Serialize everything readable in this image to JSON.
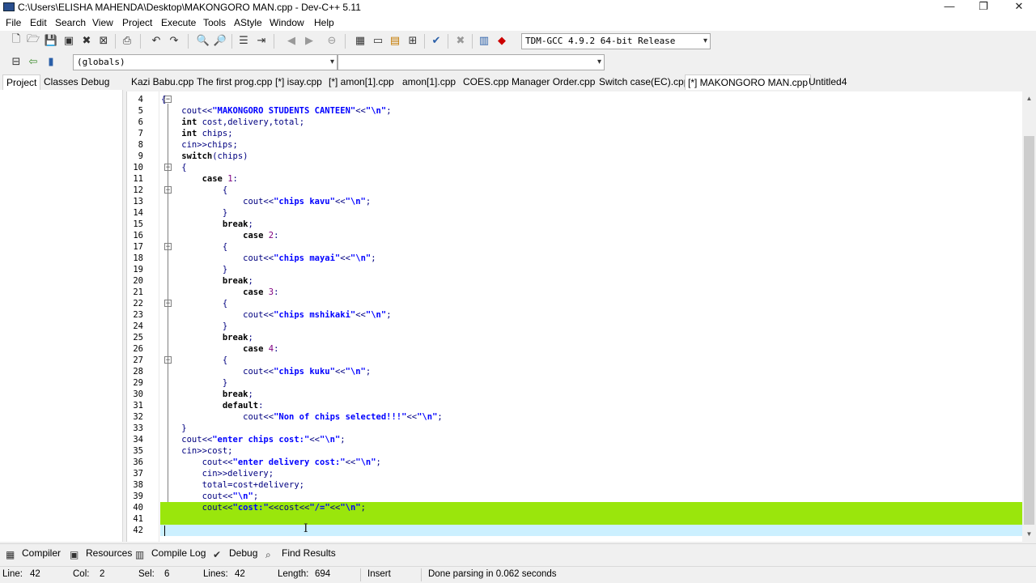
{
  "window": {
    "title": "C:\\Users\\ELISHA MAHENDA\\Desktop\\MAKONGORO MAN.cpp - Dev-C++ 5.11",
    "controls": {
      "minimize": "—",
      "maximize": "❐",
      "close": "✕"
    }
  },
  "menu": [
    "File",
    "Edit",
    "Search",
    "View",
    "Project",
    "Execute",
    "Tools",
    "AStyle",
    "Window",
    "Help"
  ],
  "toolbar": {
    "compiler_select": "TDM-GCC 4.9.2 64-bit Release",
    "scope_select": "(globals)",
    "function_select": ""
  },
  "left_tabs": [
    "Project",
    "Classes",
    "Debug"
  ],
  "editor_tabs": [
    "Kazi Babu.cpp",
    "The first prog.cpp",
    "[*] isay.cpp",
    "[*] amon[1].cpp",
    "amon[1].cpp",
    "COES.cpp",
    "Manager Order.cpp",
    "Switch case(EC).cpp",
    "[*] MAKONGORO MAN.cpp",
    "Untitled4"
  ],
  "active_tab": "[*] MAKONGORO MAN.cpp",
  "code_lines": [
    {
      "n": "4",
      "t": "{"
    },
    {
      "n": "5",
      "t": "    cout<<\"MAKONGORO STUDENTS CANTEEN\"<<\"\\n\";"
    },
    {
      "n": "6",
      "t": "    int cost,delivery,total;"
    },
    {
      "n": "7",
      "t": "    int chips;"
    },
    {
      "n": "8",
      "t": "    cin>>chips;"
    },
    {
      "n": "9",
      "t": "    switch(chips)"
    },
    {
      "n": "10",
      "t": "    {"
    },
    {
      "n": "11",
      "t": "        case 1:"
    },
    {
      "n": "12",
      "t": "            {"
    },
    {
      "n": "13",
      "t": "                cout<<\"chips kavu\"<<\"\\n\";"
    },
    {
      "n": "14",
      "t": "            }"
    },
    {
      "n": "15",
      "t": "            break;"
    },
    {
      "n": "16",
      "t": "                case 2:"
    },
    {
      "n": "17",
      "t": "            {"
    },
    {
      "n": "18",
      "t": "                cout<<\"chips mayai\"<<\"\\n\";"
    },
    {
      "n": "19",
      "t": "            }"
    },
    {
      "n": "20",
      "t": "            break;"
    },
    {
      "n": "21",
      "t": "                case 3:"
    },
    {
      "n": "22",
      "t": "            {"
    },
    {
      "n": "23",
      "t": "                cout<<\"chips mshikaki\"<<\"\\n\";"
    },
    {
      "n": "24",
      "t": "            }"
    },
    {
      "n": "25",
      "t": "            break;"
    },
    {
      "n": "26",
      "t": "                case 4:"
    },
    {
      "n": "27",
      "t": "            {"
    },
    {
      "n": "28",
      "t": "                cout<<\"chips kuku\"<<\"\\n\";"
    },
    {
      "n": "29",
      "t": "            }"
    },
    {
      "n": "30",
      "t": "            break;"
    },
    {
      "n": "31",
      "t": "            default:"
    },
    {
      "n": "32",
      "t": "                cout<<\"Non of chips selected!!!\"<<\"\\n\";"
    },
    {
      "n": "33",
      "t": "    }"
    },
    {
      "n": "34",
      "t": "    cout<<\"enter chips cost:\"<<\"\\n\";"
    },
    {
      "n": "35",
      "t": "    cin>>cost;"
    },
    {
      "n": "36",
      "t": "        cout<<\"enter delivery cost:\"<<\"\\n\";"
    },
    {
      "n": "37",
      "t": "        cin>>delivery;"
    },
    {
      "n": "38",
      "t": "        total=cost+delivery;"
    },
    {
      "n": "39",
      "t": "        cout<<\"\\n\";"
    },
    {
      "n": "40",
      "t": "        cout<<\"cost:\"<<cost<<\"/=\"<<\"\\n\";"
    },
    {
      "n": "41",
      "t": ""
    },
    {
      "n": "42",
      "t": ""
    }
  ],
  "bottom_tabs": [
    "Compiler",
    "Resources",
    "Compile Log",
    "Debug",
    "Find Results"
  ],
  "status": {
    "line_label": "Line:",
    "line": "42",
    "col_label": "Col:",
    "col": "2",
    "sel_label": "Sel:",
    "sel": "6",
    "lines_label": "Lines:",
    "lines": "42",
    "length_label": "Length:",
    "length": "694",
    "mode": "Insert",
    "message": "Done parsing in 0.062 seconds"
  },
  "colors": {
    "selection_green": "#9ae60c",
    "current_line": "#ccf0ff"
  }
}
